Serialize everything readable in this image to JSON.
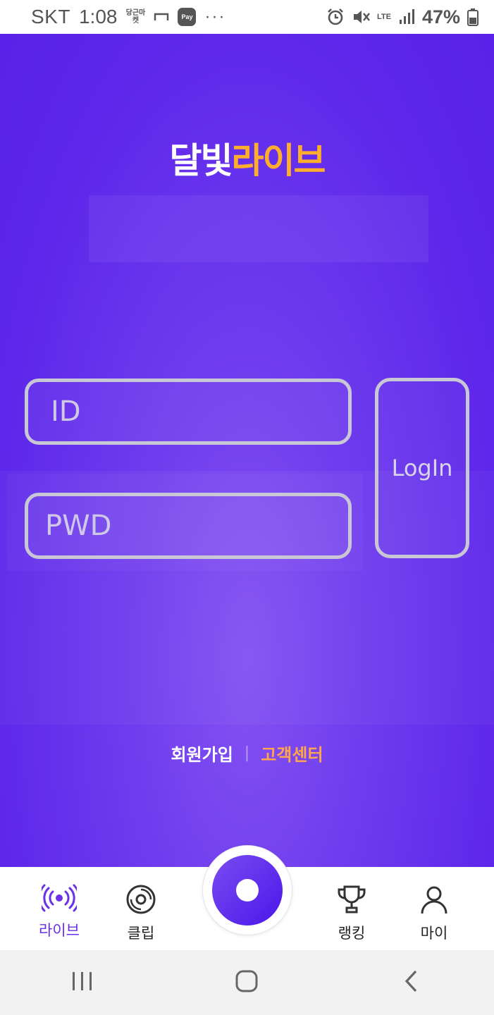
{
  "status_bar": {
    "carrier": "SKT",
    "time": "1:08",
    "notif_1": "당근마켓",
    "pay_label": "Pay",
    "more": "···",
    "network": "LTE",
    "battery": "47%"
  },
  "app": {
    "logo_part1": "달빛",
    "logo_part2": "라이브",
    "brand_color": "#5d26ea",
    "accent_color": "#ffad2c"
  },
  "login_form": {
    "id_placeholder": "ID",
    "pwd_placeholder": "PWD",
    "login_label": "LogIn"
  },
  "links": {
    "signup": "회원가입",
    "separator": "|",
    "support": "고객센터"
  },
  "bottom_nav": {
    "items": [
      {
        "label": "라이브",
        "icon": "broadcast-icon",
        "active": true
      },
      {
        "label": "클립",
        "icon": "disc-icon",
        "active": false
      },
      {
        "label": "랭킹",
        "icon": "trophy-icon",
        "active": false
      },
      {
        "label": "마이",
        "icon": "person-icon",
        "active": false
      }
    ],
    "center_icon": "record-icon"
  },
  "system_nav": {
    "icons": [
      "recent-apps-icon",
      "home-icon",
      "back-icon"
    ]
  }
}
